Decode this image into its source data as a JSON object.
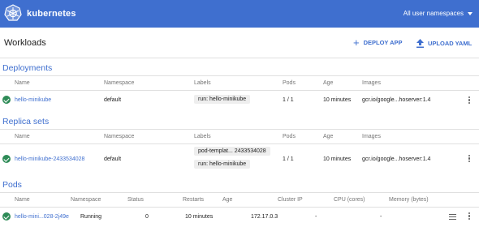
{
  "topbar": {
    "brand": "kubernetes",
    "namespace_selector": "All user namespaces"
  },
  "header": {
    "title": "Workloads",
    "deploy_label": "DEPLOY APP",
    "upload_label": "UPLOAD YAML"
  },
  "deployments": {
    "title": "Deployments",
    "columns": {
      "name": "Name",
      "namespace": "Namespace",
      "labels": "Labels",
      "pods": "Pods",
      "age": "Age",
      "images": "Images"
    },
    "rows": [
      {
        "name": "hello-minikube",
        "namespace": "default",
        "labels": [
          "run: hello-minikube"
        ],
        "pods": "1 / 1",
        "age": "10 minutes",
        "images": "gcr.io/google...hoserver:1.4"
      }
    ]
  },
  "replica_sets": {
    "title": "Replica sets",
    "columns": {
      "name": "Name",
      "namespace": "Namespace",
      "labels": "Labels",
      "pods": "Pods",
      "age": "Age",
      "images": "Images"
    },
    "rows": [
      {
        "name": "hello-minikube-2433534028",
        "namespace": "default",
        "labels": [
          "pod-templat... 2433534028",
          "run: hello-minikube"
        ],
        "pods": "1 / 1",
        "age": "10 minutes",
        "images": "gcr.io/google...hoserver:1.4"
      }
    ]
  },
  "pods": {
    "title": "Pods",
    "columns": {
      "name": "Name",
      "namespace": "Namespace",
      "status": "Status",
      "restarts": "Restarts",
      "age": "Age",
      "cluster_ip": "Cluster IP",
      "cpu": "CPU (cores)",
      "memory": "Memory (bytes)"
    },
    "rows": [
      {
        "name": "hello-mini...028-2j49e",
        "status": "Running",
        "restarts": "0",
        "age": "10 minutes",
        "cluster_ip": "172.17.0.3",
        "cpu": "-",
        "memory": "-"
      }
    ]
  },
  "colors": {
    "primary": "#3f6fcf",
    "success": "#2e8b57"
  },
  "icons": {
    "logo": "kubernetes-wheel-icon",
    "deploy": "plus-icon",
    "upload": "upload-icon",
    "status": "check-circle-icon",
    "menu": "more-vert-icon",
    "logs": "logs-icon"
  }
}
